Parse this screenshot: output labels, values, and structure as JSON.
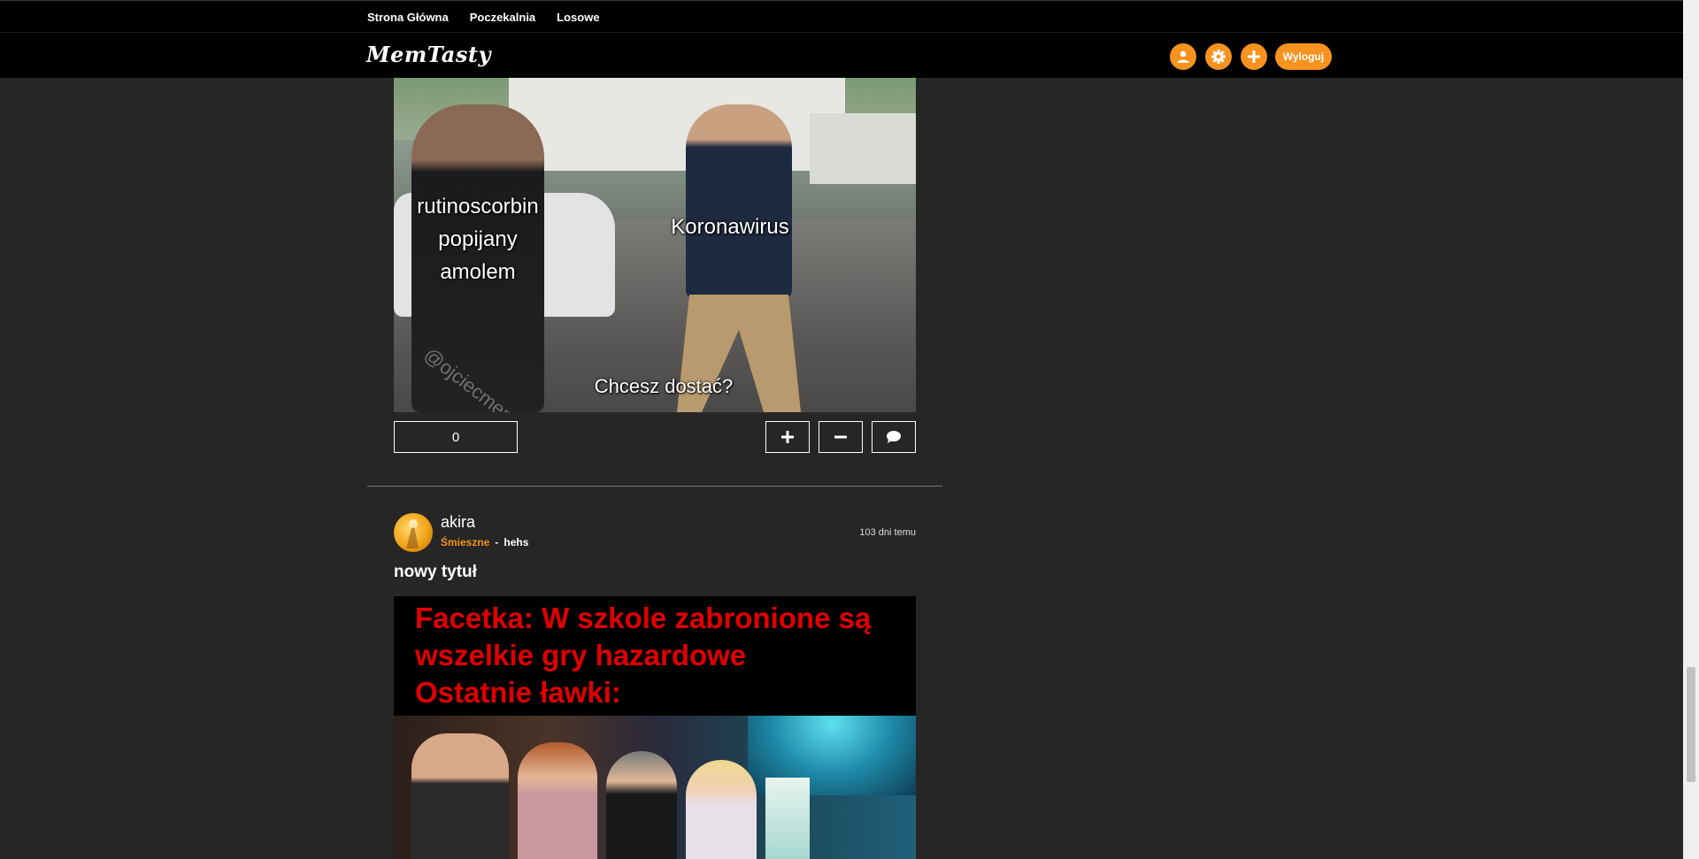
{
  "topnav": {
    "items": [
      "Strona Główna",
      "Poczekalnia",
      "Losowe"
    ]
  },
  "header": {
    "logo": "MemTasty",
    "icons": [
      "user-icon",
      "gear-icon",
      "plus-icon"
    ],
    "logout_label": "Wyloguj",
    "accent_color": "#f7931e"
  },
  "post1": {
    "image_text": {
      "left": [
        "rutinoscorbin",
        "popijany",
        "amolem"
      ],
      "right": "Koronawirus",
      "bottom": "Chcesz dostać?",
      "watermark": "@ojciecmeme"
    },
    "score": "0",
    "actions": [
      "plus-icon",
      "minus-icon",
      "comment-icon"
    ]
  },
  "post2": {
    "author": "akira",
    "category": "Śmieszne",
    "separator": "-",
    "tag": "hehs",
    "time": "103 dni temu",
    "title": "nowy tytuł",
    "image_text": [
      "Facetka: W szkole zabronione są",
      "wszelkie gry hazardowe",
      "Ostatnie ławki:"
    ]
  }
}
